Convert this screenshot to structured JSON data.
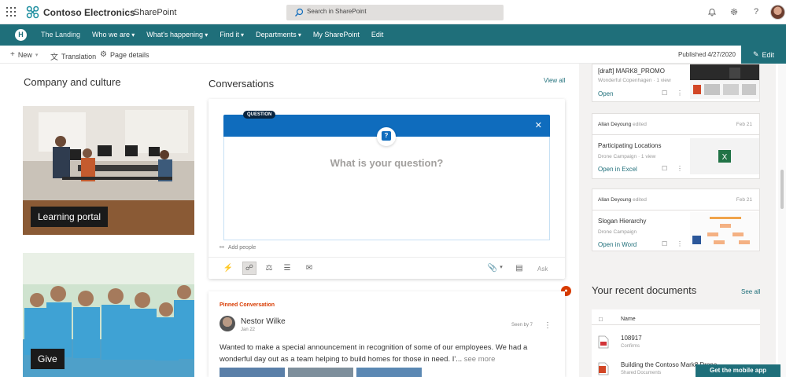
{
  "suitebar": {
    "brand": "Contoso Electronics",
    "app": "SharePoint",
    "search_placeholder": "Search in SharePoint",
    "icons": [
      "waffle-icon",
      "bell-icon",
      "gear-icon",
      "help-icon",
      "avatar"
    ]
  },
  "hubnav": {
    "logo_letter": "H",
    "site_title": "The Landing",
    "items": [
      {
        "label": "Who we are"
      },
      {
        "label": "What's happening"
      },
      {
        "label": "Find it"
      },
      {
        "label": "Departments"
      },
      {
        "label": "My SharePoint"
      },
      {
        "label": "Edit"
      }
    ]
  },
  "commandbar": {
    "new_label": "New",
    "translation_label": "Translation",
    "page_details_label": "Page details",
    "published": "Published 4/27/2020",
    "edit_label": "Edit"
  },
  "company": {
    "title": "Company and culture",
    "tiles": [
      {
        "label": "Learning portal"
      },
      {
        "label": "Give"
      }
    ]
  },
  "conversations": {
    "title": "Conversations",
    "view_all": "View all",
    "question_badge": "QUESTION",
    "question_placeholder": "What is your question?",
    "add_people": "Add people",
    "ask_label": "Ask",
    "pinned": {
      "label": "Pinned Conversation",
      "author": "Nestor Wilke",
      "date": "Jan 22",
      "seen_by": "Seen by 7",
      "body": "Wanted to make a special announcement in recognition of some of our employees. We had a wonderful day out as a team helping to build homes for those in need. I'...",
      "see_more": "see more"
    }
  },
  "documents": {
    "cards": [
      {
        "title": "[draft] MARK8_PROMO",
        "sub": "Wonderful Copenhagen · 1 view",
        "open": "Open"
      },
      {
        "who": "Allan Deyoung",
        "action": "edited",
        "when": "Feb 21",
        "title": "Participating Locations",
        "sub": "Drone Campaign · 1 view",
        "open": "Open in Excel"
      },
      {
        "who": "Allan Deyoung",
        "action": "edited",
        "when": "Feb 21",
        "title": "Slogan Hierarchy",
        "sub": "Drone Campaign",
        "open": "Open in Word"
      }
    ]
  },
  "recent": {
    "title": "Your recent documents",
    "see_all": "See all",
    "col_name": "Name",
    "rows": [
      {
        "title": "108917",
        "sub": "Confirms"
      },
      {
        "title": "Building the Contoso Mark8 Drone",
        "sub": "Shared Documents"
      }
    ]
  },
  "mobile_button": "Get the mobile app",
  "colors": {
    "theme": "#1f6f7a",
    "question_blue": "#0f6cbd",
    "pinned_orange": "#d83b01"
  }
}
